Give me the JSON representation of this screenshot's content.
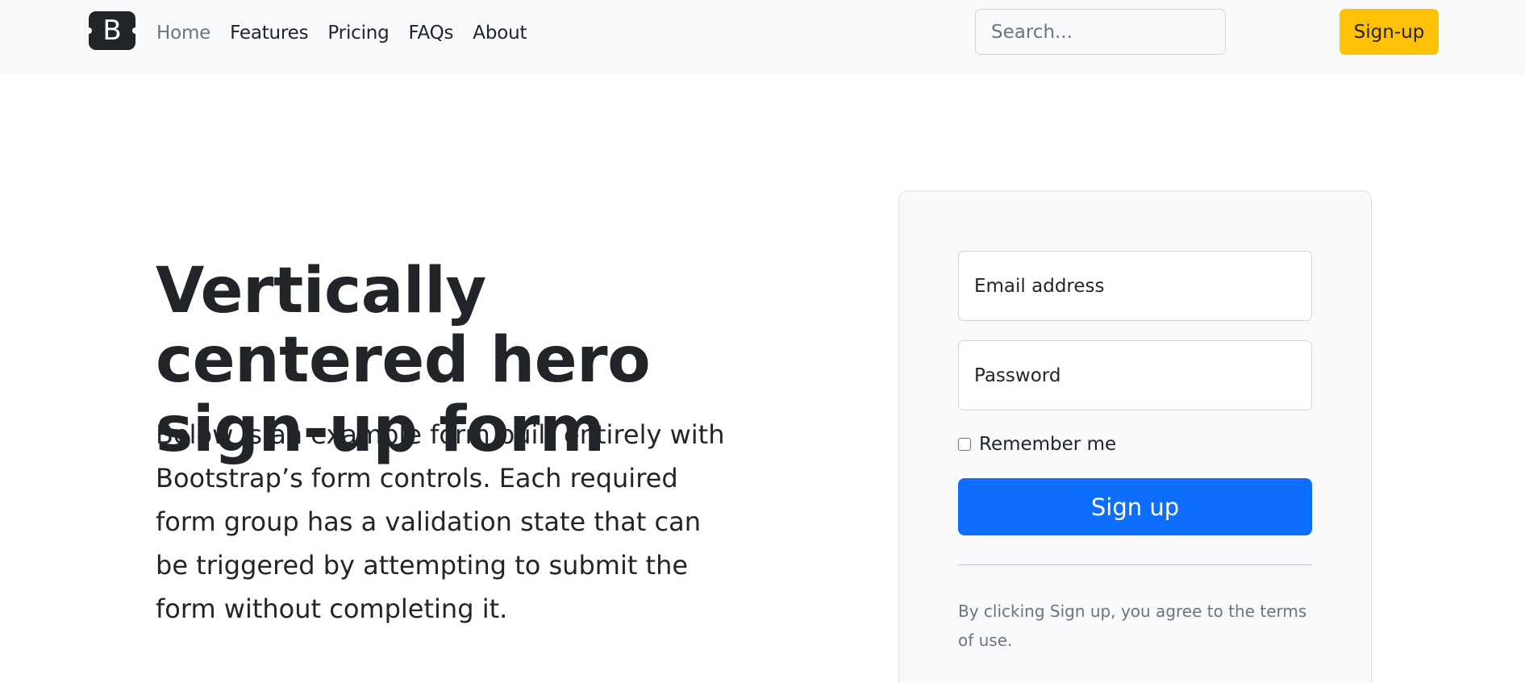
{
  "header": {
    "logo_letter": "B",
    "nav": [
      {
        "label": "Home",
        "active": true
      },
      {
        "label": "Features"
      },
      {
        "label": "Pricing"
      },
      {
        "label": "FAQs"
      },
      {
        "label": "About"
      }
    ],
    "search": {
      "placeholder": "Search..."
    },
    "signup_label": "Sign-up"
  },
  "hero": {
    "title": "Vertically centered hero sign-up form",
    "text": "Below is an example form built entirely with Bootstrap’s form controls. Each required form group has a validation state that can be triggered by attempting to submit the form without completing it."
  },
  "form": {
    "email_label": "Email address",
    "password_label": "Password",
    "remember_label": "Remember me",
    "submit_label": "Sign up",
    "terms": "By clicking Sign up, you agree to the terms of use."
  },
  "colors": {
    "primary": "#0d6efd",
    "warning": "#ffc107",
    "dark": "#212529",
    "light": "#f8f9fa",
    "muted": "#6c757d"
  }
}
